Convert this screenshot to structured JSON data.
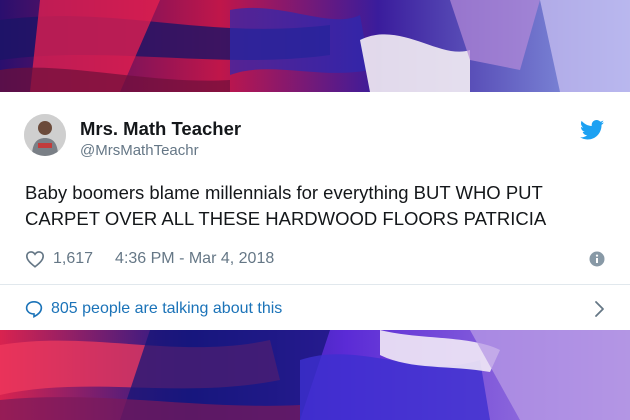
{
  "colors": {
    "text_primary": "#14171a",
    "text_secondary": "#657786",
    "link_blue": "#1b73b8",
    "twitter_blue": "#1da1f2",
    "card_bg": "#ffffff",
    "divider": "#e1e8ed"
  },
  "tweet": {
    "display_name": "Mrs. Math Teacher",
    "handle": "@MrsMathTeachr",
    "text": "Baby boomers blame millennials for everything BUT WHO PUT CARPET OVER ALL THESE HARDWOOD FLOORS PATRICIA",
    "likes": "1,617",
    "timestamp": "4:36 PM - Mar 4, 2018",
    "talking": "805 people are talking about this"
  },
  "icons": {
    "brand": "twitter-bird-icon",
    "like": "heart-icon",
    "info": "info-icon",
    "reply": "speech-bubble-icon",
    "more": "chevron-right-icon"
  }
}
